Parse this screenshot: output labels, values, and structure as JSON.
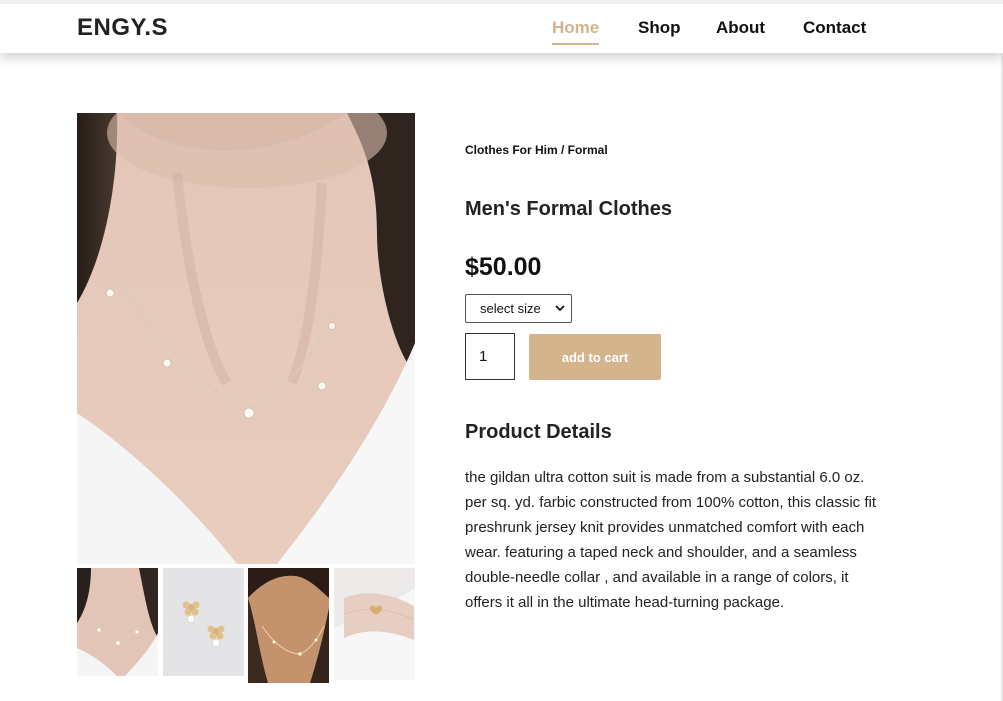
{
  "brand": "ENGY.S",
  "nav": {
    "items": [
      {
        "label": "Home",
        "active": true
      },
      {
        "label": "Shop",
        "active": false
      },
      {
        "label": "About",
        "active": false
      },
      {
        "label": "Contact",
        "active": false
      }
    ]
  },
  "product": {
    "breadcrumb": "Clothes For Him / Formal",
    "title": "Men's Formal Clothes",
    "price": "$50.00",
    "size_select": {
      "selected": "select size"
    },
    "quantity": "1",
    "add_to_cart_label": "add to cart",
    "details_heading": "Product Details",
    "details_text": "the gildan ultra cotton suit is made from a substantial 6.0 oz. per sq. yd. farbic constructed from 100% cotton, this classic fit preshrunk jersey knit provides unmatched comfort with each wear. featuring a taped neck and shoulder, and a seamless double-needle collar , and available in a range of colors, it offers it all in the ultimate head-turning package."
  },
  "gallery": {
    "main_image": "pearl-necklace-photo",
    "thumbnails": [
      "pearl-necklace-thumb",
      "flower-earrings-thumb",
      "gold-necklace-thumb",
      "heart-bracelet-thumb"
    ]
  },
  "colors": {
    "accent": "#d3b48c",
    "text": "#111111"
  }
}
